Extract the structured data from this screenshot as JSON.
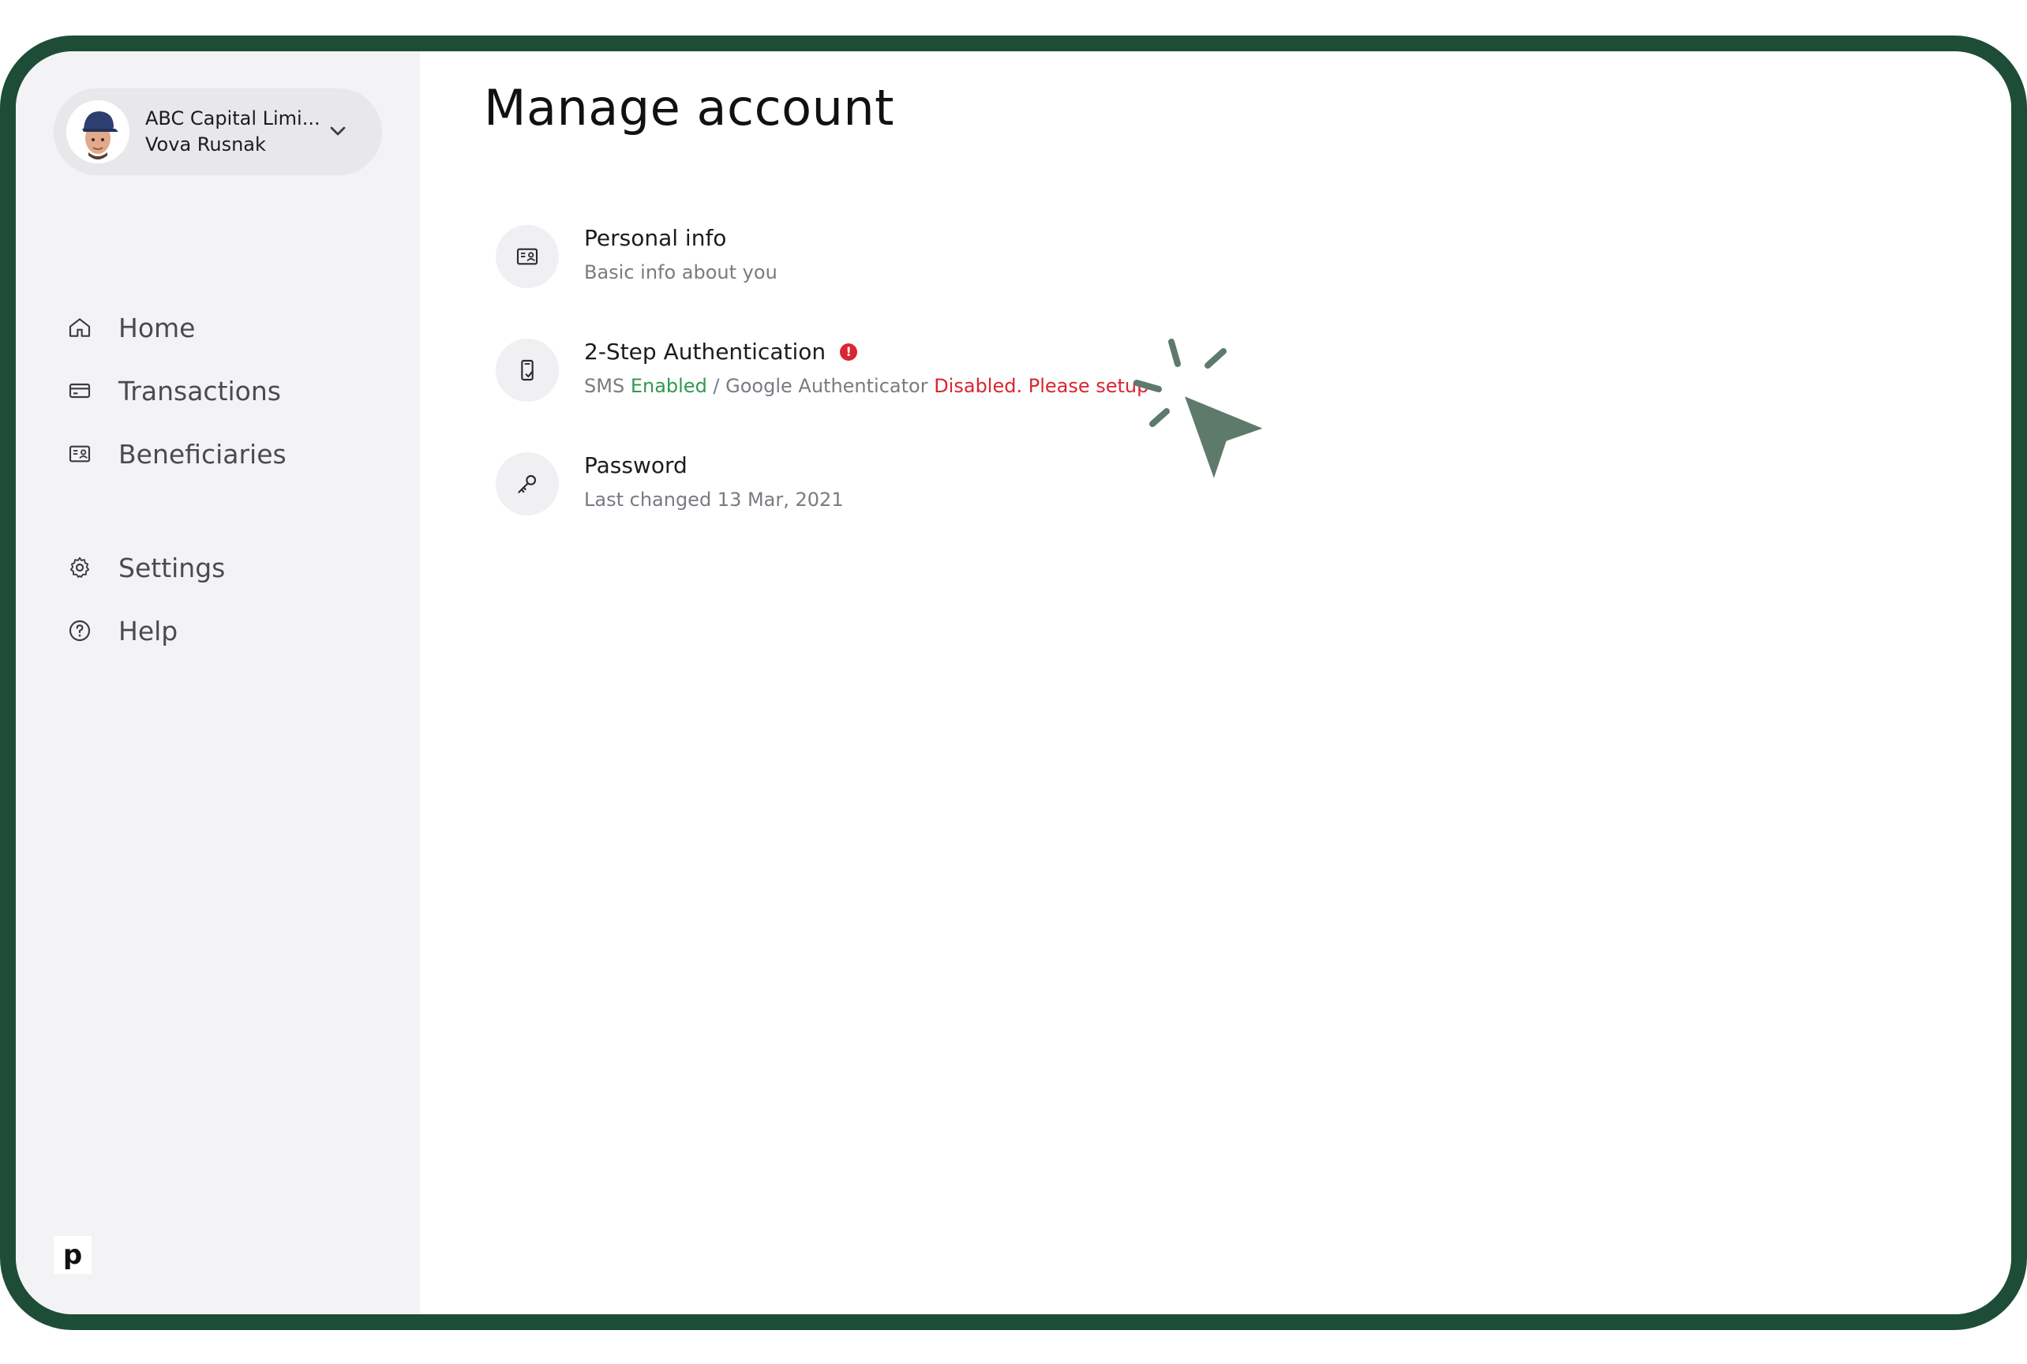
{
  "account": {
    "company": "ABC Capital Limi...",
    "user": "Vova Rusnak"
  },
  "sidebar": {
    "items": [
      {
        "label": "Home",
        "icon": "home-icon"
      },
      {
        "label": "Transactions",
        "icon": "card-icon"
      },
      {
        "label": "Beneficiaries",
        "icon": "contact-card-icon"
      },
      {
        "label": "Settings",
        "icon": "gear-icon"
      },
      {
        "label": "Help",
        "icon": "help-circle-icon"
      }
    ],
    "brand_letter": "p"
  },
  "main": {
    "title": "Manage account",
    "items": [
      {
        "title": "Personal info",
        "subtitle": "Basic info about you",
        "icon": "contact-card-icon"
      },
      {
        "title": "2-Step Authentication",
        "badge": "!",
        "subtitle_parts": {
          "sms": "SMS ",
          "sms_status": "Enabled",
          "separator": " / Google Authenticator ",
          "ga_status": "Disabled. Please setup"
        },
        "icon": "phone-check-icon"
      },
      {
        "title": "Password",
        "subtitle": "Last changed 13 Mar, 2021",
        "icon": "key-icon"
      }
    ]
  },
  "colors": {
    "frame": "#1e4d37",
    "sidebar_bg": "#f3f3f5",
    "enabled": "#2e9a4e",
    "disabled": "#d92630",
    "cursor": "#5d7a6b"
  }
}
